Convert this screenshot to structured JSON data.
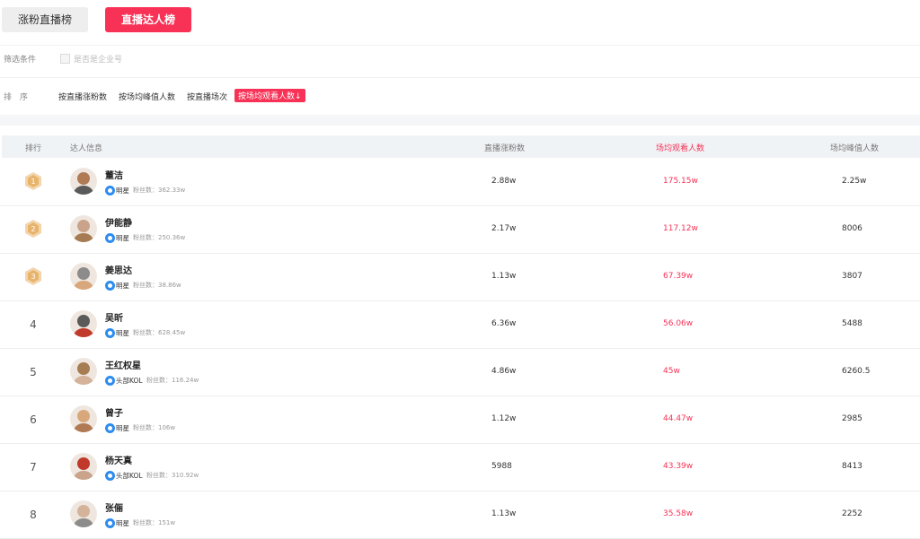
{
  "tabs": [
    {
      "label": "涨粉直播榜",
      "active": false
    },
    {
      "label": "直播达人榜",
      "active": true
    }
  ],
  "filter": {
    "label": "筛选条件",
    "checkbox_label": "是否是企业号",
    "checked": false
  },
  "sort": {
    "label": "排序",
    "options": [
      "按直播涨粉数",
      "按场均峰值人数",
      "按直播场次",
      "按场均观看人数↓"
    ],
    "active_index": 3
  },
  "table": {
    "headers": [
      "排行",
      "达人信息",
      "直播涨粉数",
      "场均观看人数",
      "场均峰值人数"
    ],
    "fans_prefix": "粉丝数：",
    "rows": [
      {
        "rank": "1",
        "name": "董洁",
        "tag": "明星",
        "fans": "362.33w",
        "live_fans": "2.88w",
        "avg_viewers": "175.15w",
        "peak": "2.25w"
      },
      {
        "rank": "2",
        "name": "伊能静",
        "tag": "明星",
        "fans": "250.36w",
        "live_fans": "2.17w",
        "avg_viewers": "117.12w",
        "peak": "8006"
      },
      {
        "rank": "3",
        "name": "姜思达",
        "tag": "明星",
        "fans": "38.86w",
        "live_fans": "1.13w",
        "avg_viewers": "67.39w",
        "peak": "3807"
      },
      {
        "rank": "4",
        "name": "吴昕",
        "tag": "明星",
        "fans": "628.45w",
        "live_fans": "6.36w",
        "avg_viewers": "56.06w",
        "peak": "5488"
      },
      {
        "rank": "5",
        "name": "王红权星",
        "tag": "头部KOL",
        "fans": "116.24w",
        "live_fans": "4.86w",
        "avg_viewers": "45w",
        "peak": "6260.5"
      },
      {
        "rank": "6",
        "name": "曾子",
        "tag": "明星",
        "fans": "106w",
        "live_fans": "1.12w",
        "avg_viewers": "44.47w",
        "peak": "2985"
      },
      {
        "rank": "7",
        "name": "杨天真",
        "tag": "头部KOL",
        "fans": "310.92w",
        "live_fans": "5988",
        "avg_viewers": "43.39w",
        "peak": "8413"
      },
      {
        "rank": "8",
        "name": "张俪",
        "tag": "明星",
        "fans": "151w",
        "live_fans": "1.13w",
        "avg_viewers": "35.58w",
        "peak": "2252"
      }
    ]
  },
  "colors": {
    "accent": "#f83256",
    "tag_icon": "#2d8cf0",
    "medal": "#e8b36a"
  }
}
